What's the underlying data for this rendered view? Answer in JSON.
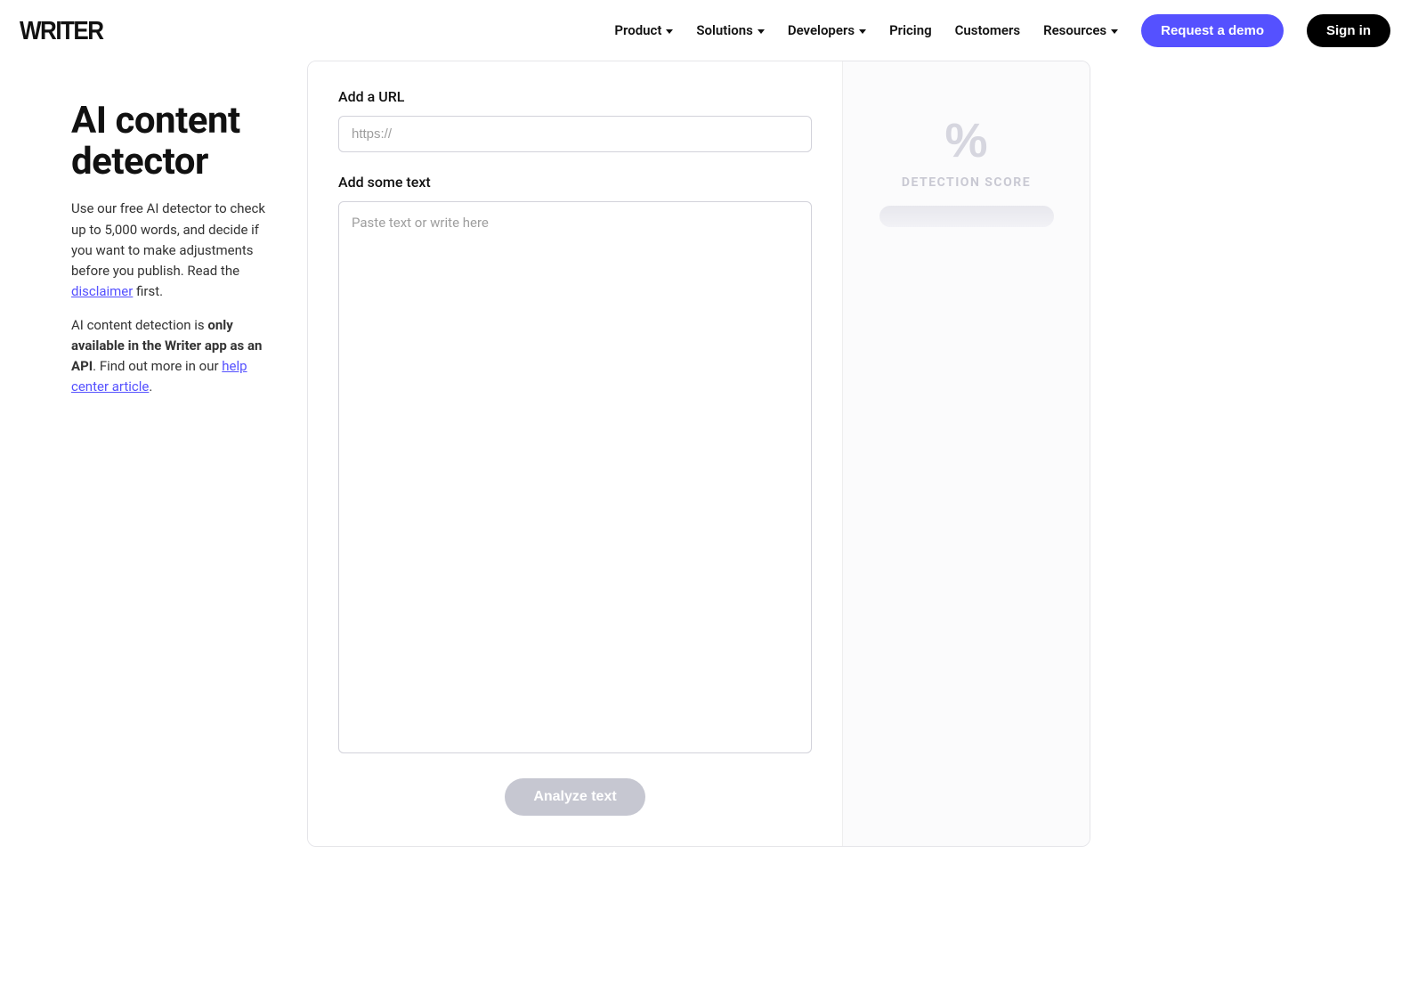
{
  "brand": "WRITER",
  "nav": {
    "items": [
      {
        "label": "Product",
        "dropdown": true
      },
      {
        "label": "Solutions",
        "dropdown": true
      },
      {
        "label": "Developers",
        "dropdown": true
      },
      {
        "label": "Pricing",
        "dropdown": false
      },
      {
        "label": "Customers",
        "dropdown": false
      },
      {
        "label": "Resources",
        "dropdown": true
      }
    ],
    "cta_primary": "Request a demo",
    "cta_signin": "Sign in"
  },
  "sidebar": {
    "title": "AI content detector",
    "p1_a": "Use our free AI detector to check up to 5,000 words, and decide if you want to make adjustments before you publish. Read the ",
    "p1_link": "disclaimer",
    "p1_b": " first.",
    "p2_a": "AI content detection is ",
    "p2_bold": "only available in the Writer app as an API",
    "p2_b": ". Find out more in our ",
    "p2_link": "help center article",
    "p2_c": "."
  },
  "form": {
    "url_label": "Add a URL",
    "url_placeholder": "https://",
    "text_label": "Add some text",
    "text_placeholder": "Paste text or write here",
    "analyze_label": "Analyze text"
  },
  "score": {
    "pct_symbol": "%",
    "label": "DETECTION SCORE"
  }
}
